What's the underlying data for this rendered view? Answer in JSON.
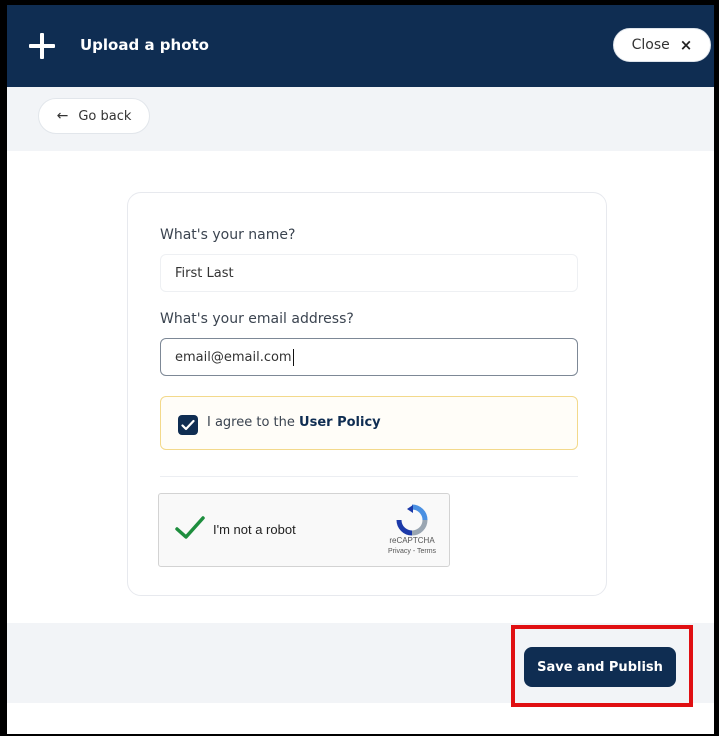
{
  "header": {
    "title": "Upload a photo",
    "close_label": "Close",
    "close_icon": "×"
  },
  "nav": {
    "back_label": "Go back",
    "back_icon": "←"
  },
  "form": {
    "name_label": "What's your name?",
    "name_value": "First Last",
    "email_label": "What's your email address?",
    "email_value": "email@email.com",
    "agree_prefix": "I agree to the",
    "agree_link": "User Policy",
    "agree_checked": true
  },
  "recaptcha": {
    "label": "I'm not a robot",
    "brand": "reCAPTCHA",
    "privacy": "Privacy - Terms",
    "checked": true
  },
  "footer": {
    "save_label": "Save and Publish"
  },
  "colors": {
    "brand_navy": "#0f2d52",
    "highlight_red": "#e00f12",
    "agree_border": "#f3d98b",
    "check_green": "#1e8e3e"
  }
}
